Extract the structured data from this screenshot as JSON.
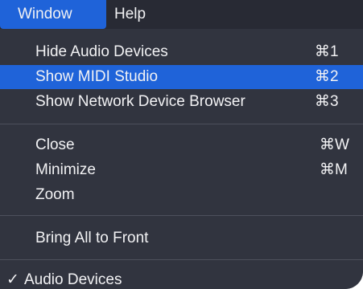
{
  "menubar": {
    "items": [
      {
        "label": "Window",
        "active": true
      },
      {
        "label": "Help",
        "active": false
      }
    ]
  },
  "menu": {
    "groups": [
      [
        {
          "label": "Hide Audio Devices",
          "shortcut": "⌘1"
        },
        {
          "label": "Show MIDI Studio",
          "shortcut": "⌘2",
          "highlighted": true
        },
        {
          "label": "Show Network Device Browser",
          "shortcut": "⌘3"
        }
      ],
      [
        {
          "label": "Close",
          "shortcut": "⌘W"
        },
        {
          "label": "Minimize",
          "shortcut": "⌘M"
        },
        {
          "label": "Zoom",
          "shortcut": ""
        }
      ],
      [
        {
          "label": "Bring All to Front",
          "shortcut": ""
        }
      ],
      [
        {
          "label": "Audio Devices",
          "checked": true,
          "check_mark": "✓"
        }
      ]
    ]
  },
  "colors": {
    "highlight": "#1f63d9",
    "menu_bg": "#31343f",
    "text": "#f2f2f4"
  }
}
